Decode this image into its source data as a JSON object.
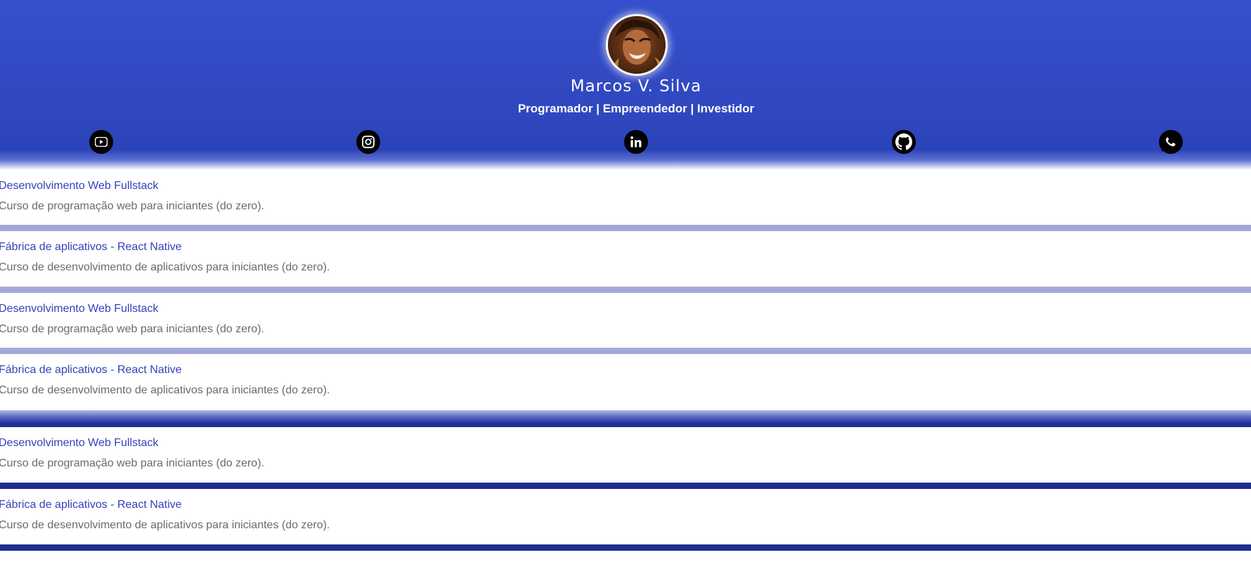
{
  "profile": {
    "name": "Marcos V. Silva",
    "tagline": "Programador | Empreendedor | Investidor",
    "avatar_icon": "avatar-portrait"
  },
  "social": [
    {
      "name": "youtube",
      "icon": "youtube-icon"
    },
    {
      "name": "instagram",
      "icon": "instagram-icon"
    },
    {
      "name": "linkedin",
      "icon": "linkedin-icon"
    },
    {
      "name": "github",
      "icon": "github-icon"
    },
    {
      "name": "whatsapp",
      "icon": "whatsapp-icon"
    }
  ],
  "courses": [
    {
      "title": "Desenvolvimento Web Fullstack",
      "description": "Curso de programação web para iniciantes (do zero)."
    },
    {
      "title": "Fábrica de aplicativos - React Native",
      "description": "Curso de desenvolvimento de aplicativos para iniciantes (do zero)."
    },
    {
      "title": "Desenvolvimento Web Fullstack",
      "description": "Curso de programação web para iniciantes (do zero)."
    },
    {
      "title": "Fábrica de aplicativos - React Native",
      "description": "Curso de desenvolvimento de aplicativos para iniciantes (do zero)."
    },
    {
      "title": "Desenvolvimento Web Fullstack",
      "description": "Curso de programação web para iniciantes (do zero)."
    },
    {
      "title": "Fábrica de aplicativos - React Native",
      "description": "Curso de desenvolvimento de aplicativos para iniciantes (do zero)."
    }
  ],
  "colors": {
    "header_blue": "#3550cc",
    "link_blue": "#3242b8",
    "separator_light": "#a2a9da",
    "separator_dark": "#1f2e8e",
    "description_gray": "#6b6b6b"
  }
}
